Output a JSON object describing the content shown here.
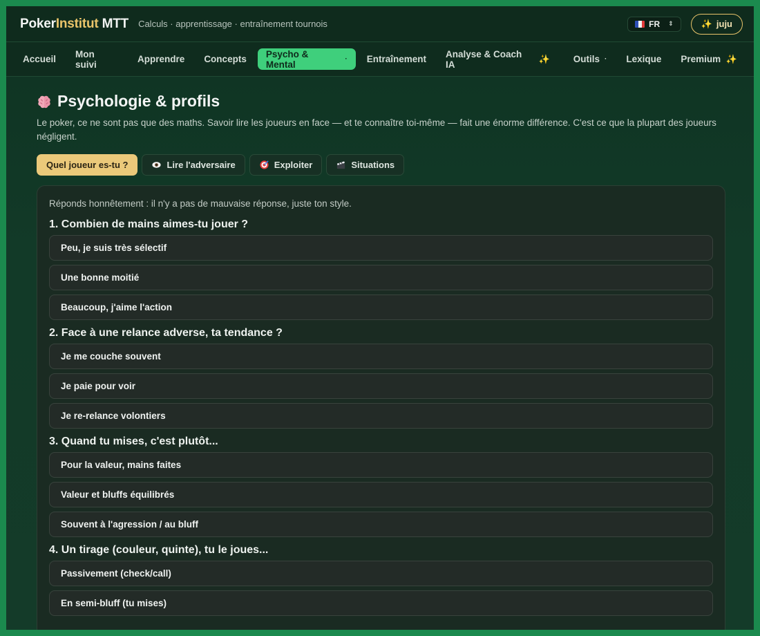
{
  "header": {
    "brand_main": "Poker",
    "brand_accent": "Institut",
    "brand_suffix": " MTT",
    "tagline": "Calculs · apprentissage · entraînement tournois",
    "language": "FR",
    "user_label": "juju"
  },
  "nav": {
    "items": [
      {
        "label": "Accueil"
      },
      {
        "label": "Mon suivi"
      },
      {
        "label": "Apprendre"
      },
      {
        "label": "Concepts"
      },
      {
        "label": "Psycho & Mental",
        "active": true
      },
      {
        "label": "Entraînement"
      },
      {
        "label": "Analyse & Coach IA"
      },
      {
        "label": "Outils"
      },
      {
        "label": "Lexique"
      },
      {
        "label": "Premium"
      }
    ]
  },
  "page": {
    "title": "Psychologie & profils",
    "intro": "Le poker, ce ne sont pas que des maths. Savoir lire les joueurs en face — et te connaître toi-même — fait une énorme différence. C'est ce que la plupart des joueurs négligent."
  },
  "tabs": [
    {
      "label": "Quel joueur es-tu ?",
      "active": true
    },
    {
      "label": "Lire l'adversaire",
      "icon": "eye-icon"
    },
    {
      "label": "Exploiter",
      "icon": "target-icon"
    },
    {
      "label": "Situations",
      "icon": "clapper-icon"
    }
  ],
  "quiz": {
    "hint": "Réponds honnêtement : il n'y a pas de mauvaise réponse, juste ton style.",
    "questions": [
      {
        "title": "1. Combien de mains aimes-tu jouer ?",
        "options": [
          "Peu, je suis très sélectif",
          "Une bonne moitié",
          "Beaucoup, j'aime l'action"
        ]
      },
      {
        "title": "2. Face à une relance adverse, ta tendance ?",
        "options": [
          "Je me couche souvent",
          "Je paie pour voir",
          "Je re-relance volontiers"
        ]
      },
      {
        "title": "3. Quand tu mises, c'est plutôt...",
        "options": [
          "Pour la valeur, mains faites",
          "Valeur et bluffs équilibrés",
          "Souvent à l'agression / au bluff"
        ]
      },
      {
        "title": "4. Un tirage (couleur, quinte), tu le joues...",
        "options": [
          "Passivement (check/call)",
          "En semi-bluff (tu mises)"
        ]
      }
    ]
  },
  "colors": {
    "frame_border": "#1b8a4e",
    "accent_green": "#3fcf7c",
    "accent_gold": "#ebc97a",
    "brand_gold": "#e9c46a"
  }
}
